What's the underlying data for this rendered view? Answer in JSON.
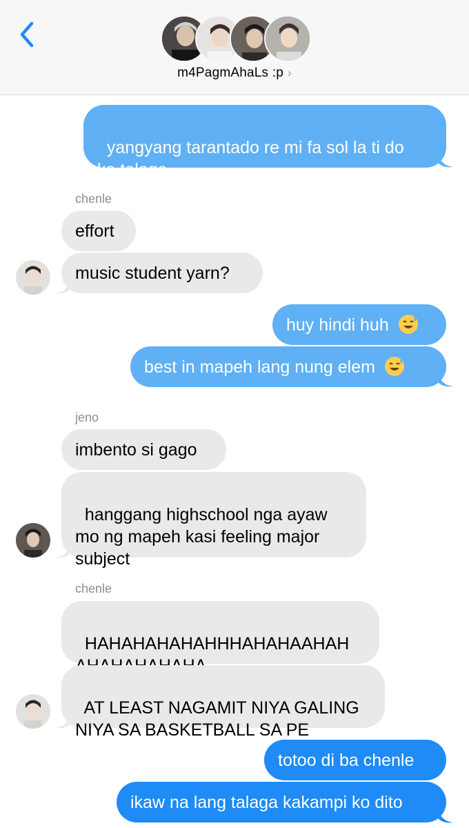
{
  "header": {
    "group_name": "m4PagmAhaLs :p",
    "chevron": "›",
    "back_icon": "chevron-left-icon",
    "accent_color": "#1e8bf6"
  },
  "messages": [
    {
      "text": "yangyang tarantado re mi fa sol la ti do\nka talaga",
      "direction": "outgoing"
    },
    {
      "sender": "chenle",
      "texts": [
        "effort",
        "music student yarn?"
      ]
    },
    {
      "text": "huy hindi huh",
      "emoji": "sweat-smile-emoji",
      "direction": "outgoing"
    },
    {
      "text": "best in mapeh lang nung elem",
      "emoji": "sweat-smile-emoji",
      "direction": "outgoing"
    },
    {
      "sender": "jeno",
      "texts": [
        "imbento si gago",
        "hanggang highschool nga ayaw\nmo ng mapeh kasi feeling major\nsubject"
      ]
    },
    {
      "sender": "chenle",
      "texts": [
        "HAHAHAHAHAHHHAHAHAAHAH\nAHAHAHAHAHA",
        "AT LEAST NAGAMIT NIYA GALING\nNIYA SA BASKETBALL SA PE"
      ]
    },
    {
      "text": "totoo di ba chenle",
      "direction": "outgoing"
    },
    {
      "text": "ikaw na lang talaga kakampi ko dito",
      "direction": "outgoing"
    }
  ],
  "colors": {
    "outgoing": "#1e8bf6",
    "outgoing_faded": "#5fb0f5",
    "incoming": "#e9e9eb"
  }
}
